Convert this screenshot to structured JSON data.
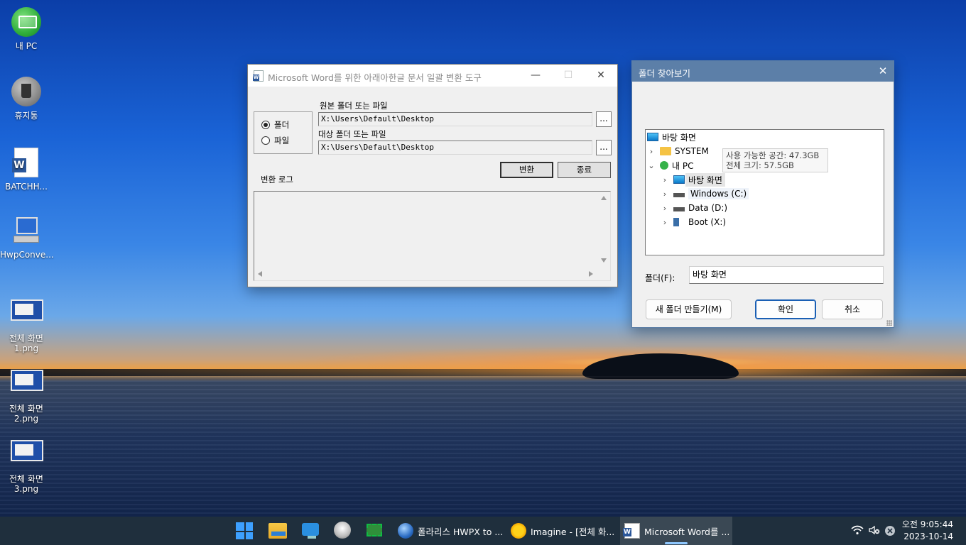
{
  "desktop": {
    "icons": [
      {
        "label": "내 PC"
      },
      {
        "label": "휴지통"
      },
      {
        "label": "BATCHH..."
      },
      {
        "label": "HwpConve..."
      },
      {
        "label_line1": "전체 화면",
        "label_line2": "1.png"
      },
      {
        "label_line1": "전체 화면",
        "label_line2": "2.png"
      },
      {
        "label_line1": "전체 화면",
        "label_line2": "3.png"
      }
    ]
  },
  "converter_window": {
    "title": "Microsoft Word를 위한 아래아한글 문서 일괄 변환 도구",
    "minimize_glyph": "—",
    "maximize_glyph": "☐",
    "close_glyph": "✕",
    "radio_folder": "폴더",
    "radio_file": "파일",
    "source_label": "원본 폴더 또는 파일",
    "source_value": "X:\\Users\\Default\\Desktop",
    "target_label": "대상 폴더 또는 파일",
    "target_value": "X:\\Users\\Default\\Desktop",
    "browse_label": "...",
    "convert_button": "변환",
    "exit_button": "종료",
    "log_label": "변환 로그"
  },
  "folder_dialog": {
    "title": "폴더 찾아보기",
    "close_glyph": "✕",
    "tree": [
      {
        "label": "바탕 화면"
      },
      {
        "label": "SYSTEM"
      },
      {
        "label": "내 PC"
      },
      {
        "label": "바탕 화면"
      },
      {
        "label": "Windows (C:)"
      },
      {
        "label": "Data (D:)"
      },
      {
        "label": "Boot (X:)"
      }
    ],
    "tooltip_line1": "사용 가능한 공간: 47.3GB",
    "tooltip_line2": "전체 크기: 57.5GB",
    "folder_label": "폴더(F):",
    "folder_value": "바탕 화면",
    "new_folder_button": "새 폴더 만들기(M)",
    "ok_button": "확인",
    "cancel_button": "취소"
  },
  "taskbar": {
    "apps": [
      {
        "label": "폴라리스 HWPX to ..."
      },
      {
        "label": "Imagine - [전체 화..."
      },
      {
        "label": "Microsoft Word를 ..."
      }
    ],
    "clock_time": "오전 9:05:44",
    "clock_date": "2023-10-14"
  },
  "colors": {
    "folder_dialog_titlebar": "#5c7fa8",
    "taskbar": "#20303c",
    "word_blue": "#2b579a"
  }
}
